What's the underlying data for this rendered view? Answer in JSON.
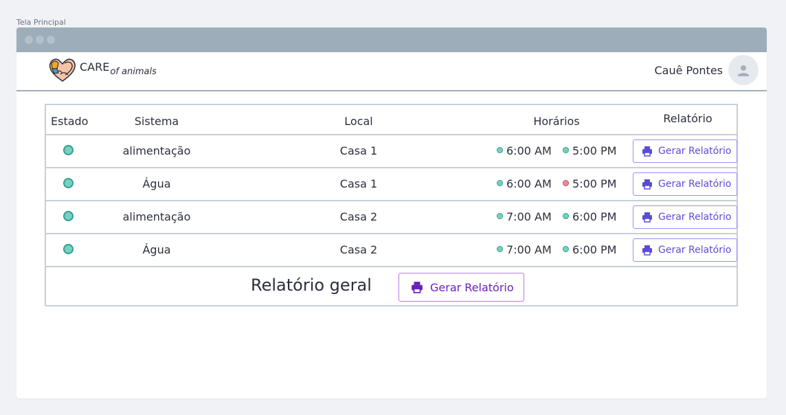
{
  "caption": "Tela Principal",
  "brand": {
    "name": "CARE",
    "suffix": "of animals"
  },
  "user": {
    "name": "Cauê Pontes"
  },
  "table": {
    "headers": [
      "Estado",
      "Sistema",
      "Local",
      "Horários",
      "Relatório"
    ],
    "rows": [
      {
        "sistema": "alimentação",
        "local": "Casa 1",
        "time1": "6:00 AM",
        "time2": "5:00 PM",
        "time2_status": "ok",
        "button": "Gerar Relatório"
      },
      {
        "sistema": "Água",
        "local": "Casa 1",
        "time1": "6:00 AM",
        "time2": "5:00 PM",
        "time2_status": "bad",
        "button": "Gerar Relatório"
      },
      {
        "sistema": "alimentação",
        "local": "Casa 2",
        "time1": "7:00 AM",
        "time2": "6:00 PM",
        "time2_status": "ok",
        "button": "Gerar Relatório"
      },
      {
        "sistema": "Água",
        "local": "Casa 2",
        "time1": "7:00 AM",
        "time2": "6:00 PM",
        "time2_status": "ok",
        "button": "Gerar Relatório"
      }
    ]
  },
  "general_report": {
    "title": "Relatório geral",
    "button": "Gerar Relatório"
  },
  "colors": {
    "status_ok": "#76d1c1",
    "status_bad": "#ef8a9a",
    "accent": "#5b4bd8",
    "accent_strong": "#6a1fb5",
    "titlebar": "#9eadba"
  },
  "icons": {
    "logo": "heart-hands-logo",
    "avatar": "user-icon",
    "print": "printer-icon"
  }
}
